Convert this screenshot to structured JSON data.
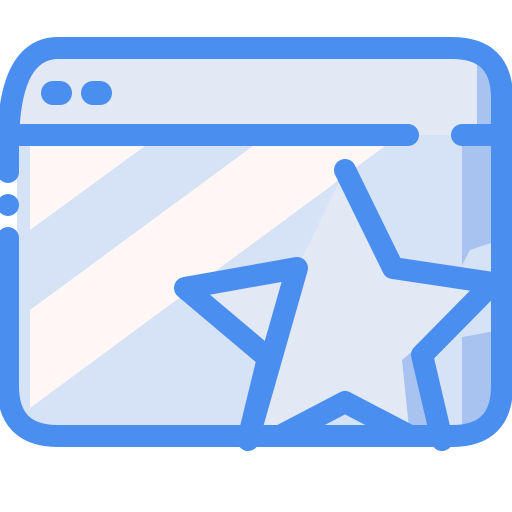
{
  "icon": {
    "name": "browser-window-star-icon",
    "colors": {
      "outline": "#4A8FF0",
      "window_fill": "#D6E2F5",
      "titlebar_fill": "#E3E8F5",
      "right_shade": "#A8C3F0",
      "highlight_stripe": "#FFF7F5",
      "star_fill": "#E3E8F5",
      "star_shade": "#A8C3F0",
      "background": "#FFFFFF"
    }
  }
}
